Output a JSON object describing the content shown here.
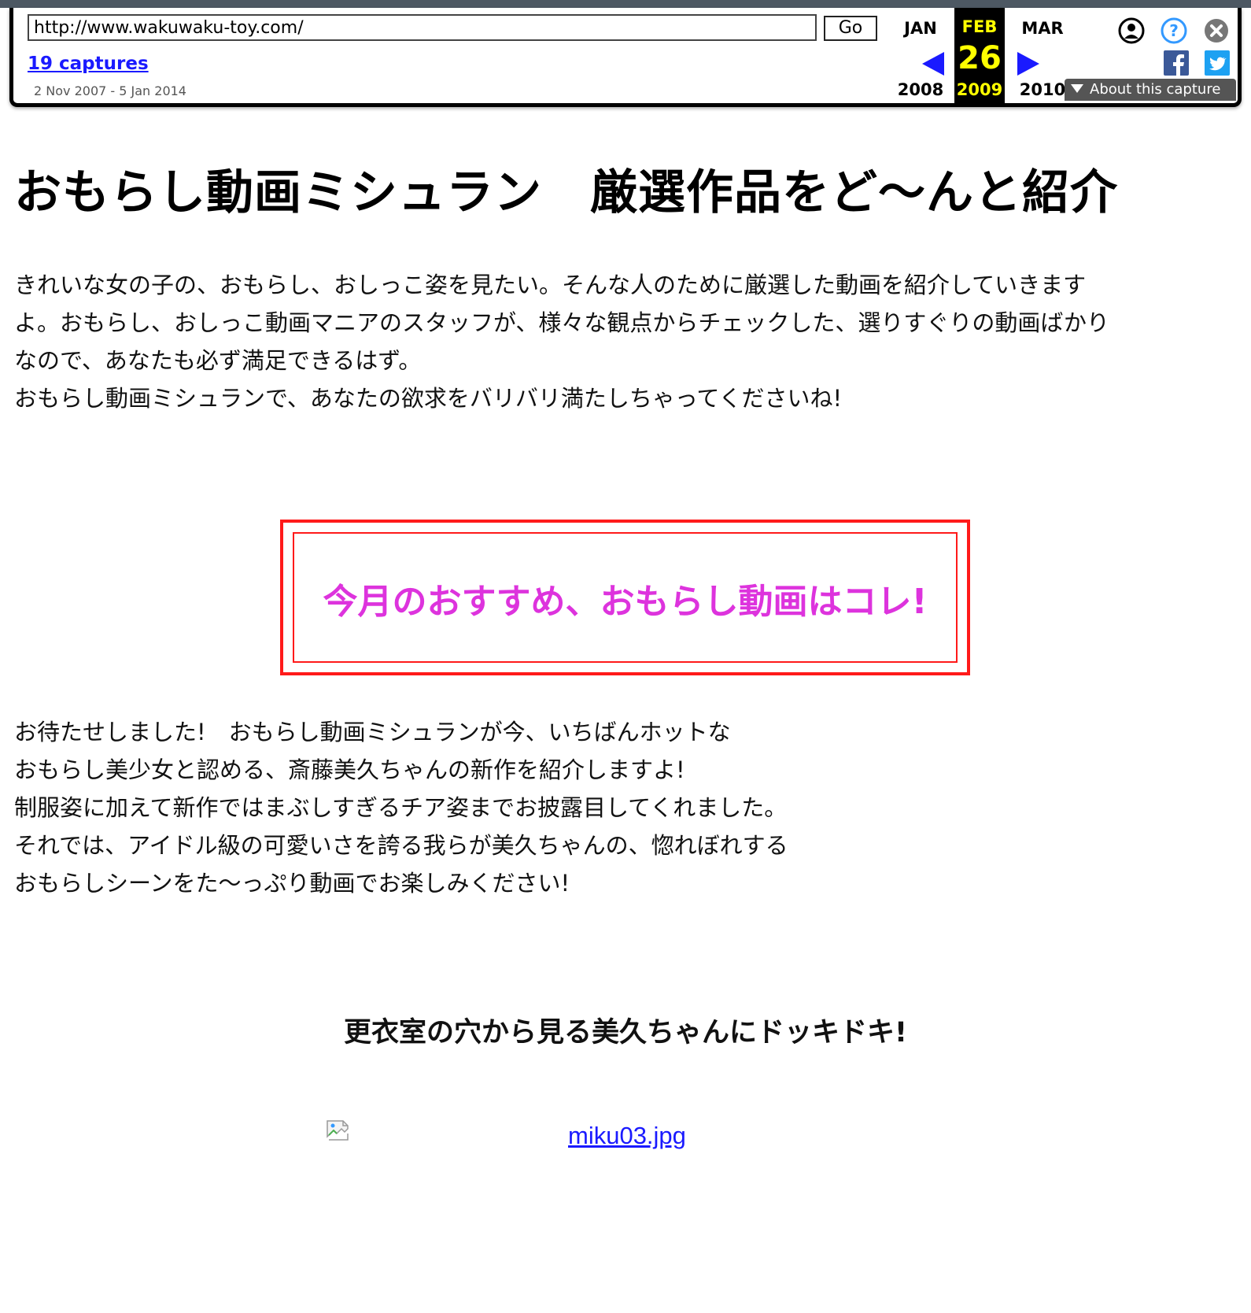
{
  "wayback": {
    "url_value": "http://www.wakuwaku-toy.com/",
    "go_label": "Go",
    "captures_link": "19 captures",
    "capture_range": "2 Nov 2007 - 5 Jan 2014",
    "calendar": {
      "prev_month": "JAN",
      "current_month": "FEB",
      "next_month": "MAR",
      "current_day": "26",
      "prev_year": "2008",
      "current_year": "2009",
      "next_year": "2010"
    },
    "about_capture_label": "About this capture",
    "icons": {
      "user": "user-circle-icon",
      "help": "question-circle-icon",
      "close": "close-circle-icon",
      "facebook": "facebook-icon",
      "twitter": "twitter-icon"
    },
    "colors": {
      "link": "#1a1aff",
      "highlight": "#ffff00",
      "arrow": "#1a1aff"
    }
  },
  "page": {
    "title": "おもらし動画ミシュラン　厳選作品をど〜んと紹介",
    "intro_lines": [
      "きれいな女の子の、おもらし、おしっこ姿を見たい。そんな人のために厳選した動画を紹介していきます",
      "よ。おもらし、おしっこ動画マニアのスタッフが、様々な観点からチェックした、選りすぐりの動画ばかり",
      "なので、あなたも必ず満足できるはず。",
      "おもらし動画ミシュランで、あなたの欲求をバリバリ満たしちゃってくださいね!"
    ],
    "featured_heading": "今月のおすすめ、おもらし動画はコレ!",
    "body_lines": [
      "お待たせしました!　おもらし動画ミシュランが今、いちばんホットな",
      "おもらし美少女と認める、斎藤美久ちゃんの新作を紹介しますよ!",
      "制服姿に加えて新作ではまぶしすぎるチア姿までお披露目してくれました。",
      "それでは、アイドル級の可愛いさを誇る我らが美久ちゃんの、惚れぼれする",
      "おもらしシーンをた〜っぷり動画でお楽しみください!"
    ],
    "sub_heading": "更衣室の穴から見る美久ちゃんにドッキドキ!",
    "image_alt_link": "miku03.jpg",
    "colors": {
      "featured_border": "#ff1a1a",
      "featured_text": "#dd33dd"
    }
  }
}
